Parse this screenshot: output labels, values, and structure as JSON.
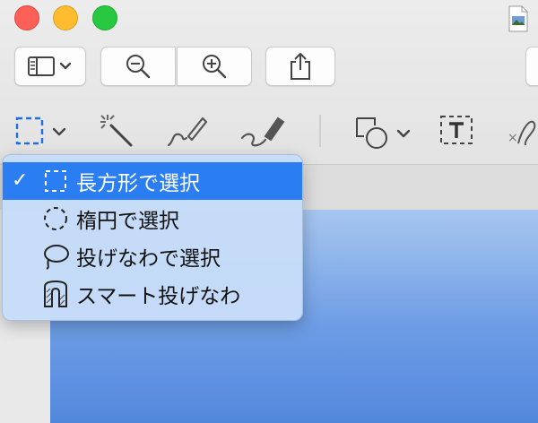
{
  "window": {
    "traffic_lights": [
      "close",
      "minimize",
      "zoom"
    ],
    "document_icon": "image-document-icon"
  },
  "toolbar": {
    "buttons": [
      "sidebar-toggle-icon",
      "zoom-out-icon",
      "zoom-in-icon",
      "share-icon"
    ]
  },
  "markup_tools": [
    "rectangular-selection-icon",
    "magic-wand-icon",
    "sketch-icon",
    "draw-icon",
    "shapes-icon",
    "text-box-icon",
    "signature-icon"
  ],
  "selection_menu": {
    "items": [
      {
        "label": "長方形で選択",
        "icon": "rectangle-selection-icon",
        "checked": true
      },
      {
        "label": "楕円で選択",
        "icon": "ellipse-selection-icon",
        "checked": false
      },
      {
        "label": "投げなわで選択",
        "icon": "lasso-selection-icon",
        "checked": false
      },
      {
        "label": "スマート投げなわ",
        "icon": "smart-lasso-icon",
        "checked": false
      }
    ],
    "check_glyph": "✓"
  },
  "colors": {
    "menu_background": "#c6dcf8",
    "selected_item": "#2b7df2",
    "accent_blue": "#1f6fe0"
  }
}
